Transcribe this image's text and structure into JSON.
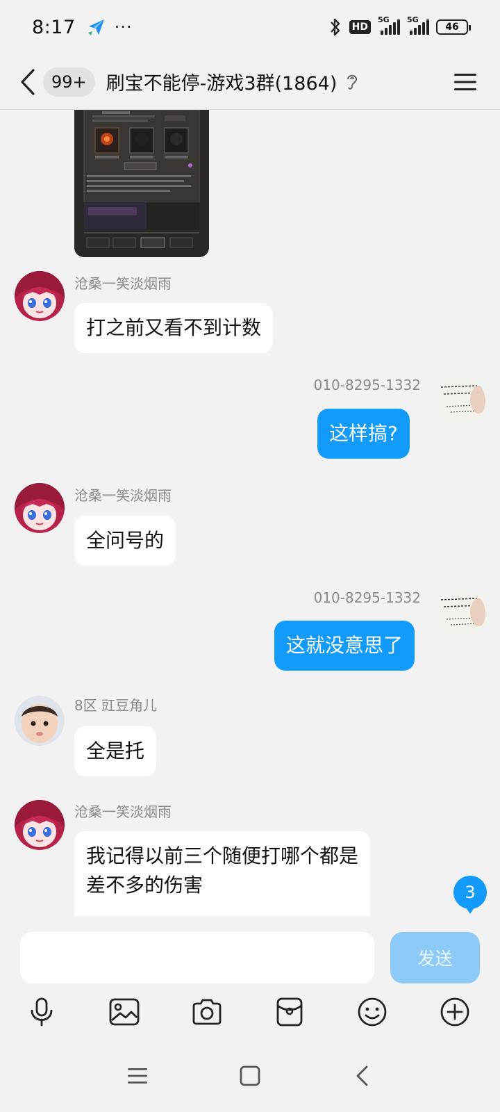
{
  "status_bar": {
    "time": "8:17",
    "dots": "···",
    "hd_badge": "HD",
    "network_1": "5G",
    "network_2": "5G",
    "battery": "46",
    "icons": [
      "send-app-icon",
      "bluetooth-icon",
      "hd-icon",
      "signal-icon",
      "signal-icon",
      "battery-icon"
    ]
  },
  "header": {
    "unread_count": "99+",
    "title": "刷宝不能停-游戏3群(1864)",
    "icons": [
      "back-icon",
      "ear-icon",
      "menu-icon"
    ]
  },
  "messages": [
    {
      "sender": "沧桑一笑淡烟雨",
      "text": "打之前又看不到计数",
      "side": "left",
      "avatar": "anime-avatar"
    },
    {
      "sender": "010-8295-1332",
      "text": "这样搞?",
      "side": "right",
      "avatar": "calligraphy-avatar"
    },
    {
      "sender": "沧桑一笑淡烟雨",
      "text": "全问号的",
      "side": "left",
      "avatar": "anime-avatar"
    },
    {
      "sender": "010-8295-1332",
      "text": "这就没意思了",
      "side": "right",
      "avatar": "calligraphy-avatar"
    },
    {
      "sender": "8区 豇豆角儿",
      "text": "全是托",
      "side": "left",
      "avatar": "baby-photo-avatar"
    },
    {
      "sender": "沧桑一笑淡烟雨",
      "text_line1": "我记得以前三个随便打哪个都是",
      "text_line2": "差不多的伤害",
      "side": "left",
      "avatar": "anime-avatar"
    }
  ],
  "new_message_badge": "3",
  "input": {
    "placeholder": "",
    "value": "",
    "send_label": "发送"
  },
  "toolbar": [
    "microphone-icon",
    "image-icon",
    "camera-icon",
    "red-packet-icon",
    "emoji-icon",
    "plus-icon"
  ],
  "nav": [
    "recent-apps-icon",
    "home-icon",
    "back-nav-icon"
  ],
  "colors": {
    "background": "#f2f2f2",
    "bubble_self": "#129bfa",
    "bubble_other": "#ffffff",
    "send_disabled": "#8dcaf8"
  }
}
